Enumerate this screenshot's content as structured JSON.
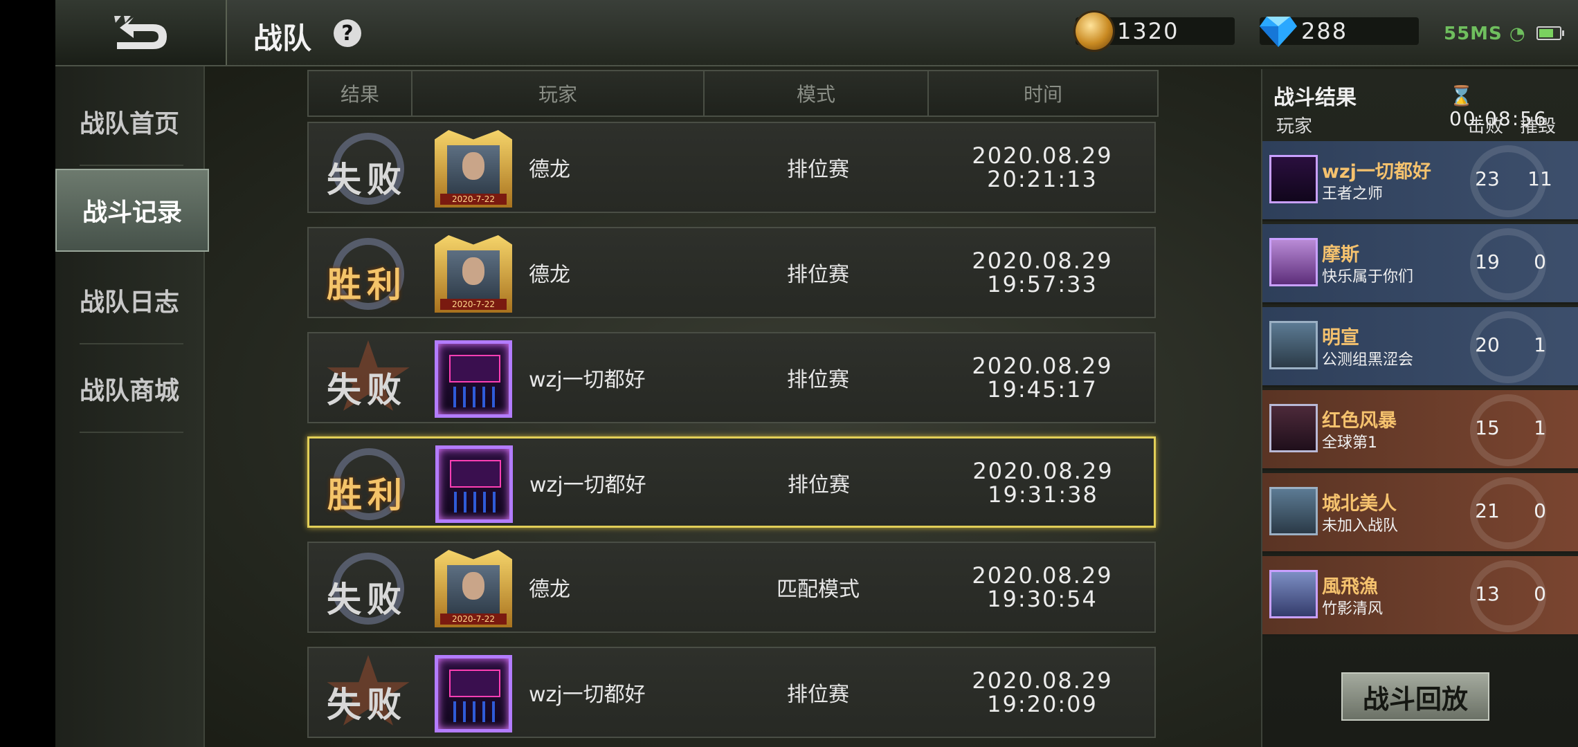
{
  "header": {
    "title": "战队",
    "help_label": "?",
    "gold": "1320",
    "diamonds": "288",
    "network": "55MS"
  },
  "sidebar": {
    "items": [
      {
        "label": "战队首页",
        "active": false
      },
      {
        "label": "战斗记录",
        "active": true
      },
      {
        "label": "战队日志",
        "active": false
      },
      {
        "label": "战队商城",
        "active": false
      }
    ]
  },
  "table": {
    "headers": [
      "结果",
      "玩家",
      "模式",
      "时间"
    ],
    "rows": [
      {
        "result": "失败",
        "avatar": "gold-frame-portrait",
        "avatar_date": "2020-7-22",
        "player": "德龙",
        "mode": "排位赛",
        "date": "2020.08.29",
        "time": "20:21:13",
        "selected": false
      },
      {
        "result": "胜利",
        "avatar": "gold-frame-portrait",
        "avatar_date": "2020-7-22",
        "player": "德龙",
        "mode": "排位赛",
        "date": "2020.08.29",
        "time": "19:57:33",
        "selected": false
      },
      {
        "result": "失败",
        "avatar": "purple-frame-portrait",
        "avatar_date": "",
        "player": "wzj一切都好",
        "mode": "排位赛",
        "date": "2020.08.29",
        "time": "19:45:17",
        "selected": false
      },
      {
        "result": "胜利",
        "avatar": "purple-frame-portrait",
        "avatar_date": "",
        "player": "wzj一切都好",
        "mode": "排位赛",
        "date": "2020.08.29",
        "time": "19:31:38",
        "selected": true
      },
      {
        "result": "失败",
        "avatar": "gold-frame-portrait",
        "avatar_date": "2020-7-22",
        "player": "德龙",
        "mode": "匹配模式",
        "date": "2020.08.29",
        "time": "19:30:54",
        "selected": false
      },
      {
        "result": "失败",
        "avatar": "purple-frame-portrait",
        "avatar_date": "",
        "player": "wzj一切都好",
        "mode": "排位赛",
        "date": "2020.08.29",
        "time": "19:20:09",
        "selected": false
      }
    ]
  },
  "battle_result": {
    "title": "战斗结果",
    "timer": "00:08:56",
    "col_player": "玩家",
    "col_kills": "击败",
    "col_destroy": "摧毁",
    "players": [
      {
        "name": "wzj一切都好",
        "title": "王者之师",
        "kills": "23",
        "destroy": "11",
        "team": "blue"
      },
      {
        "name": "摩斯",
        "title": "快乐属于你们",
        "kills": "19",
        "destroy": "0",
        "team": "blue"
      },
      {
        "name": "明宣",
        "title": "公测组黑涩会",
        "kills": "20",
        "destroy": "1",
        "team": "blue"
      },
      {
        "name": "红色风暴",
        "title": "全球第1",
        "kills": "15",
        "destroy": "1",
        "team": "red"
      },
      {
        "name": "城北美人",
        "title": "未加入战队",
        "kills": "21",
        "destroy": "0",
        "team": "red"
      },
      {
        "name": "風飛漁",
        "title": "竹影清风",
        "kills": "13",
        "destroy": "0",
        "team": "red"
      }
    ],
    "replay_label": "战斗回放"
  },
  "colors": {
    "win": "#f4c46a",
    "lose": "#d8d8d8",
    "selected_border": "#e2cf58",
    "team_blue": "#3d4f6c",
    "team_red": "#7a4530"
  }
}
